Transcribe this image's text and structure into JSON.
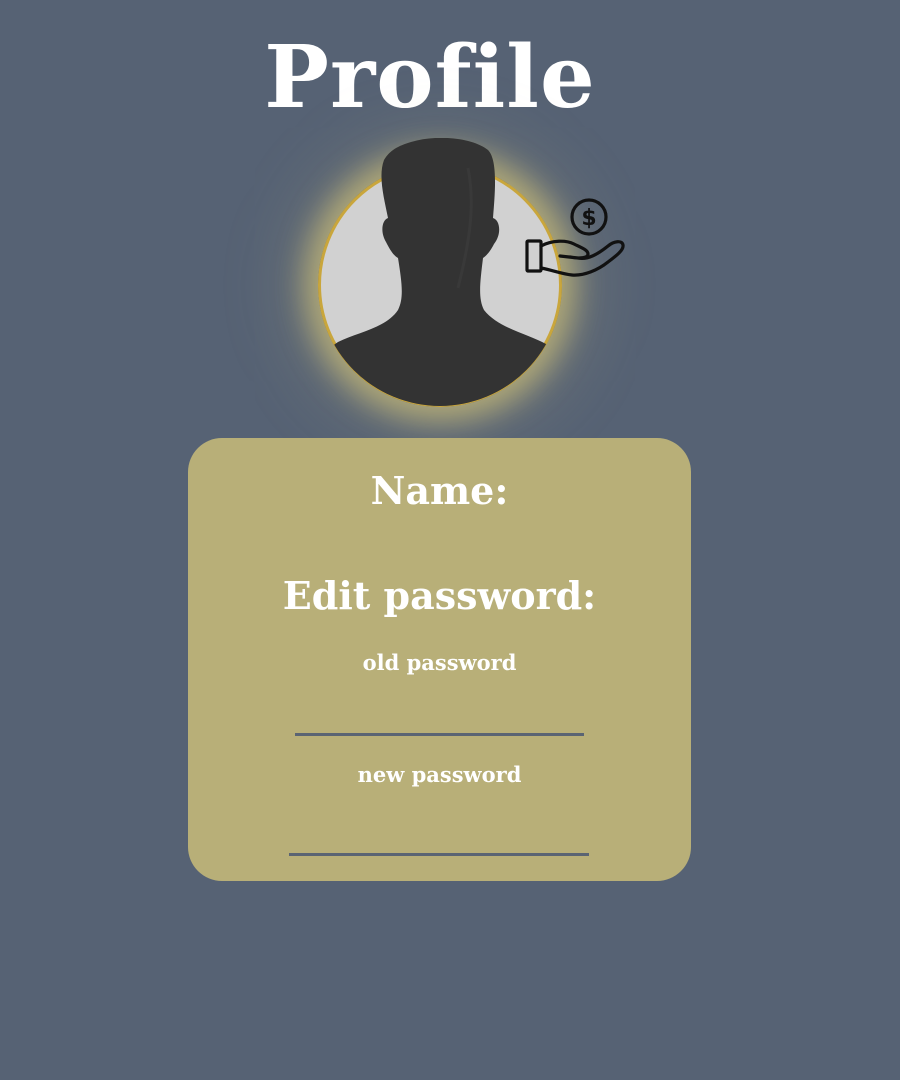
{
  "page": {
    "title": "Profile",
    "background_color": "#566274"
  },
  "avatar": {
    "icon": "user-silhouette-icon",
    "ring_color": "#c9a63c",
    "glow_color": "#e9d678"
  },
  "money_icon": {
    "icon": "hand-holding-dollar-icon",
    "symbol": "$"
  },
  "card": {
    "background_color": "#b8af78",
    "name_label": "Name:",
    "edit_password_label": "Edit password:",
    "old_password_label": "old password",
    "new_password_label": "new password",
    "old_password_value": "",
    "new_password_value": "",
    "input_underline_color": "#5a6473"
  }
}
